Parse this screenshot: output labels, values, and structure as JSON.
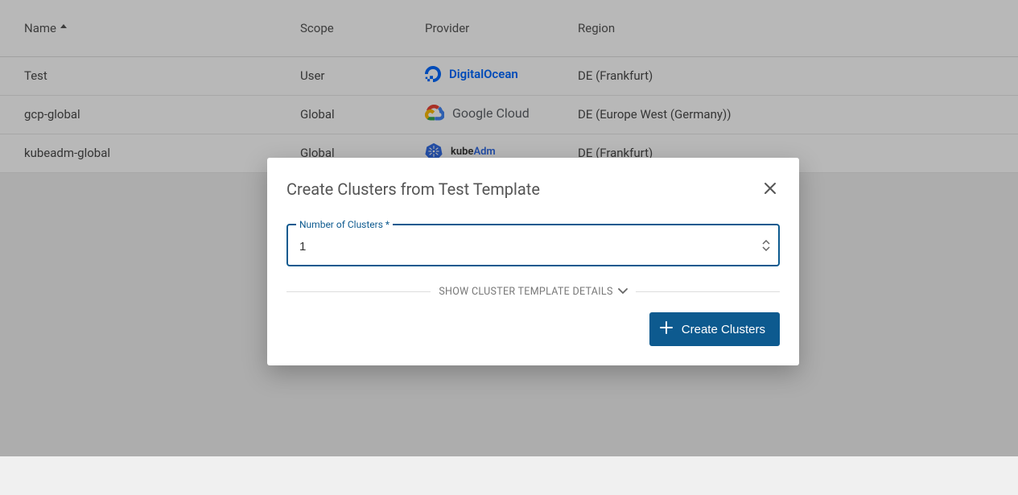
{
  "table": {
    "headers": {
      "name": "Name",
      "scope": "Scope",
      "provider": "Provider",
      "region": "Region"
    },
    "rows": [
      {
        "name": "Test",
        "scope": "User",
        "provider": "DigitalOcean",
        "provider_key": "digitalocean",
        "region": "DE (Frankfurt)"
      },
      {
        "name": "gcp-global",
        "scope": "Global",
        "provider": "Google Cloud",
        "provider_key": "gcp",
        "region": "DE (Europe West (Germany))"
      },
      {
        "name": "kubeadm-global",
        "scope": "Global",
        "provider": "kubeAdm",
        "provider_key": "kubeadm",
        "region": "DE (Frankfurt)"
      }
    ]
  },
  "modal": {
    "title": "Create Clusters from Test Template",
    "field_label": "Number of Clusters",
    "field_required_mark": "*",
    "field_value": "1",
    "toggle_details": "SHOW CLUSTER TEMPLATE DETAILS",
    "submit_label": "Create Clusters"
  },
  "colors": {
    "accent": "#0d5a8f",
    "do_blue": "#0069ff",
    "kube_blue": "#326ce5"
  }
}
